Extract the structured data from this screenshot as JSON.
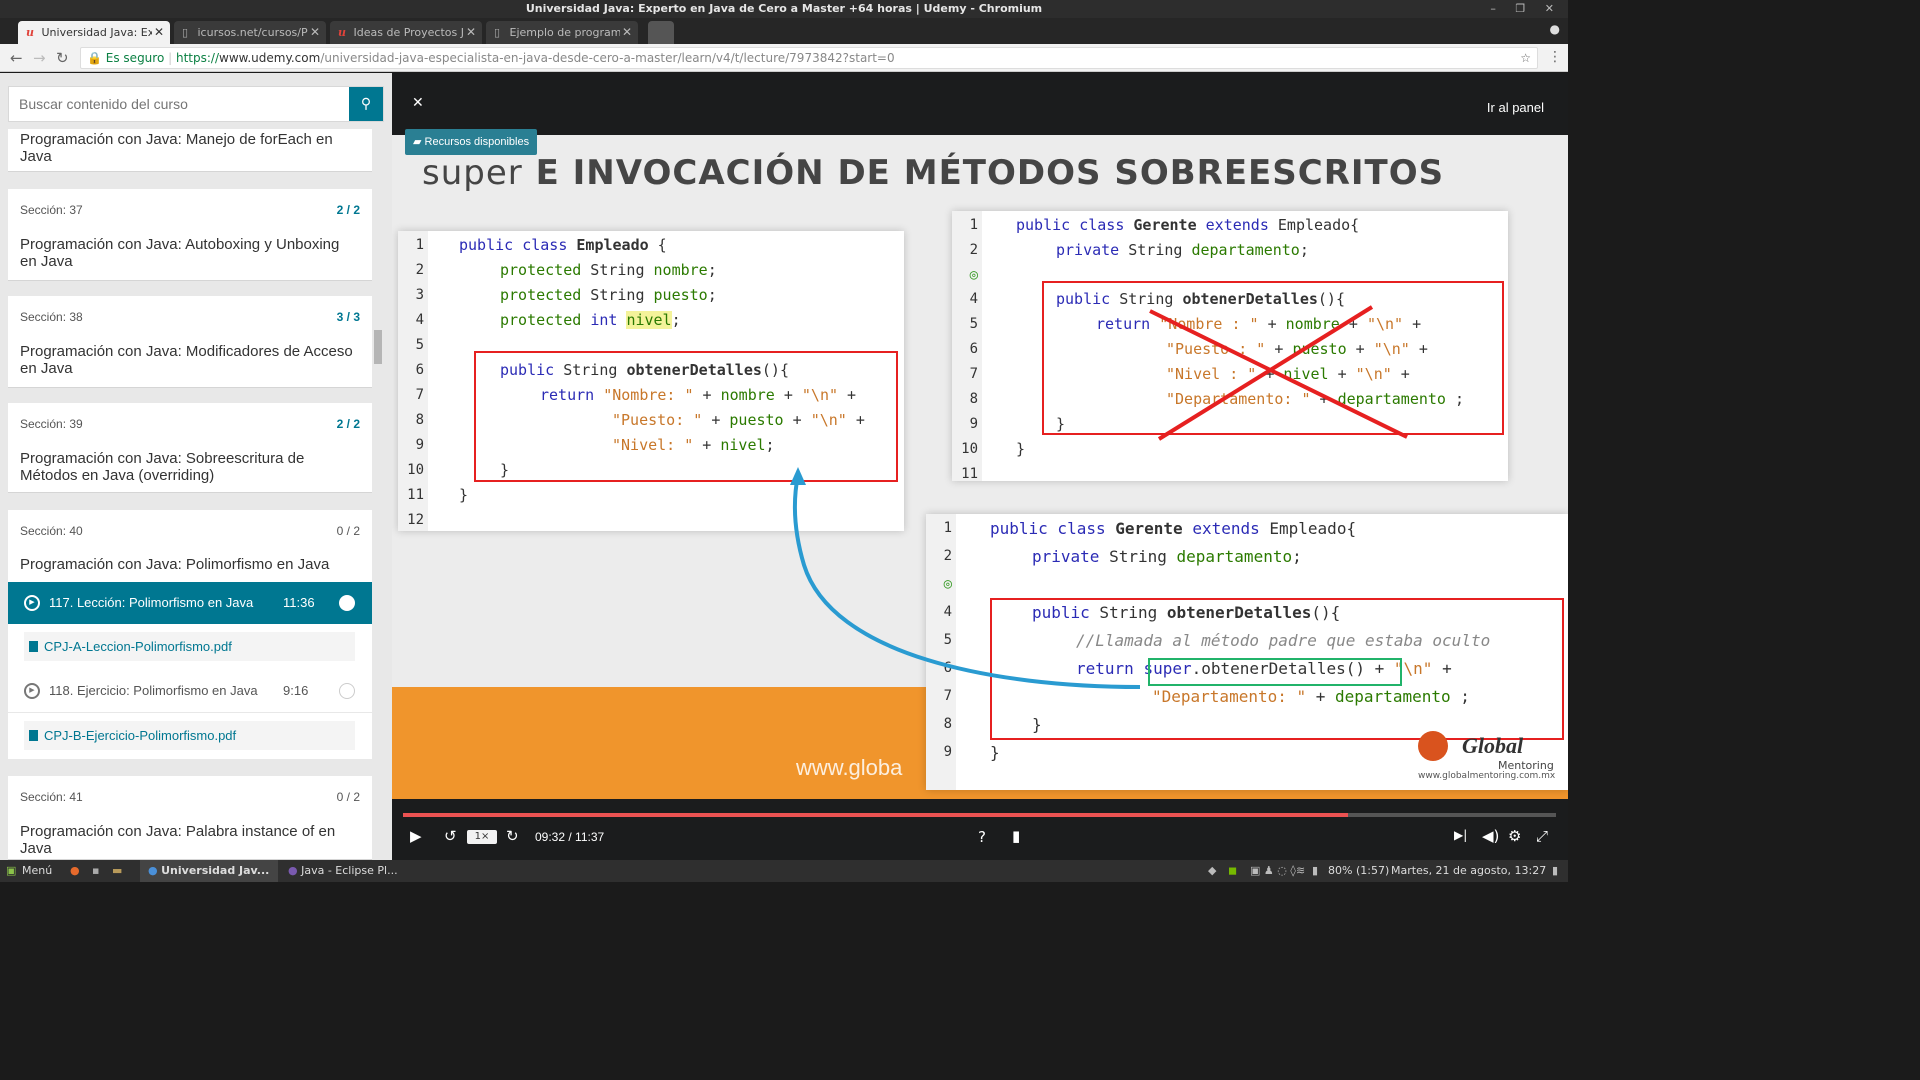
{
  "window": {
    "title": "Universidad Java: Experto en Java de Cero a Master +64 horas | Udemy - Chromium"
  },
  "tabs": [
    {
      "label": "Universidad Java: Exp",
      "favicon": "u",
      "active": true
    },
    {
      "label": "icursos.net/cursos/Prog",
      "favicon": "page",
      "active": false
    },
    {
      "label": "Ideas de Proyectos Java",
      "favicon": "u",
      "active": false
    },
    {
      "label": "Ejemplo de programa Ja",
      "favicon": "page",
      "active": false
    }
  ],
  "address": {
    "secure_label": "Es seguro",
    "scheme": "https://",
    "host": "www.udemy.com",
    "path": "/universidad-java-especialista-en-java-desde-cero-a-master/learn/v4/t/lecture/7973842?start=0"
  },
  "sidebar": {
    "search_placeholder": "Buscar contenido del curso",
    "partial_section_title": "Programación con Java: Manejo de forEach en Java",
    "sections": [
      {
        "label": "Sección: 37",
        "count": "2 / 2",
        "title": "Programación con Java: Autoboxing y Unboxing en Java"
      },
      {
        "label": "Sección: 38",
        "count": "3 / 3",
        "title": "Programación con Java: Modificadores de Acceso en Java"
      },
      {
        "label": "Sección: 39",
        "count": "2 / 2",
        "title": "Programación con Java: Sobreescritura de Métodos en Java (overriding)"
      },
      {
        "label": "Sección: 40",
        "count": "0 / 2",
        "title": "Programación con Java: Polimorfismo en Java"
      },
      {
        "label": "Sección: 41",
        "count": "0 / 2",
        "title": "Programación con Java: Palabra instance of en Java"
      }
    ],
    "lectures": [
      {
        "title": "117. Lección: Polimorfismo en Java",
        "duration": "11:36",
        "resource": "CPJ-A-Leccion-Polimorfismo.pdf"
      },
      {
        "title": "118. Ejercicio: Polimorfismo en Java",
        "duration": "9:16",
        "resource": "CPJ-B-Ejercicio-Polimorfismo.pdf"
      }
    ]
  },
  "player": {
    "go_panel": "Ir al panel",
    "resources_label": "Recursos disponibles",
    "time": "09:32 / 11:37",
    "rate": "1×",
    "progress_fraction": 0.82
  },
  "slide": {
    "heading_light": "super",
    "heading_bold": "E INVOCACIÓN DE MÉTODOS SOBREESCRITOS",
    "www": "www.globa",
    "logo_name": "Global",
    "logo_sub": "Mentoring",
    "logo_url": "www.globalmentoring.com.mx",
    "empleado_lines": [
      "1",
      "2",
      "3",
      "4",
      "5",
      "6",
      "7",
      "8",
      "9",
      "10",
      "11",
      "12"
    ],
    "gerente1_lines": [
      "1",
      "2",
      "3",
      "4",
      "5",
      "6",
      "7",
      "8",
      "9",
      "10",
      "11"
    ],
    "gerente2_lines": [
      "1",
      "2",
      "3",
      "4",
      "5",
      "6",
      "7",
      "8",
      "9"
    ]
  },
  "taskbar": {
    "menu": "Menú",
    "app1": "Universidad Jav...",
    "app2": "Java - Eclipse Pl...",
    "battery": "80% (1:57)",
    "datetime": "Martes, 21 de agosto, 13:27"
  }
}
